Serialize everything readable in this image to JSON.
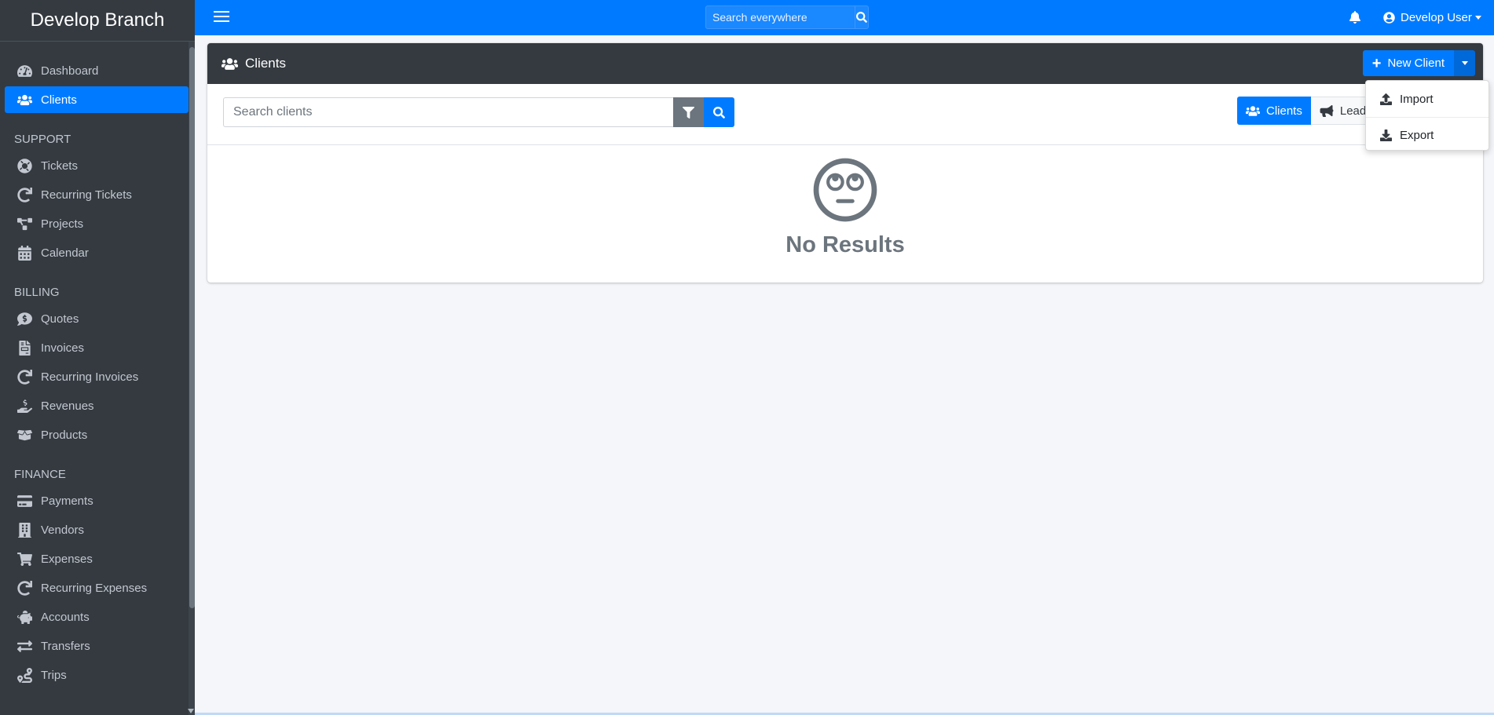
{
  "brand": "Develop Branch",
  "sidebar": {
    "top_items": [
      {
        "label": "Dashboard",
        "icon": "dashboard-icon"
      },
      {
        "label": "Clients",
        "icon": "users-icon",
        "active": true
      }
    ],
    "sections": [
      {
        "header": "SUPPORT",
        "items": [
          {
            "label": "Tickets",
            "icon": "life-ring-icon"
          },
          {
            "label": "Recurring Tickets",
            "icon": "redo-icon"
          },
          {
            "label": "Projects",
            "icon": "project-diagram-icon"
          },
          {
            "label": "Calendar",
            "icon": "calendar-icon"
          }
        ]
      },
      {
        "header": "BILLING",
        "items": [
          {
            "label": "Quotes",
            "icon": "comment-dollar-icon"
          },
          {
            "label": "Invoices",
            "icon": "file-invoice-icon"
          },
          {
            "label": "Recurring Invoices",
            "icon": "redo-icon"
          },
          {
            "label": "Revenues",
            "icon": "hand-holding-usd-icon"
          },
          {
            "label": "Products",
            "icon": "box-open-icon"
          }
        ]
      },
      {
        "header": "FINANCE",
        "items": [
          {
            "label": "Payments",
            "icon": "credit-card-icon"
          },
          {
            "label": "Vendors",
            "icon": "building-icon"
          },
          {
            "label": "Expenses",
            "icon": "shopping-cart-icon"
          },
          {
            "label": "Recurring Expenses",
            "icon": "redo-icon"
          },
          {
            "label": "Accounts",
            "icon": "piggy-bank-icon"
          },
          {
            "label": "Transfers",
            "icon": "exchange-icon"
          },
          {
            "label": "Trips",
            "icon": "route-icon"
          }
        ]
      }
    ]
  },
  "topbar": {
    "search_placeholder": "Search everywhere",
    "user_name": "Develop User"
  },
  "card": {
    "title": "Clients",
    "new_button": "New Client",
    "search_placeholder": "Search clients",
    "toggle": {
      "clients": "Clients",
      "leads": "Leads"
    },
    "empty_text": "No Results"
  },
  "dropdown": {
    "import": "Import",
    "export": "Export"
  },
  "colors": {
    "primary": "#007bff",
    "sidebar": "#343a40",
    "muted": "#6c757d"
  }
}
